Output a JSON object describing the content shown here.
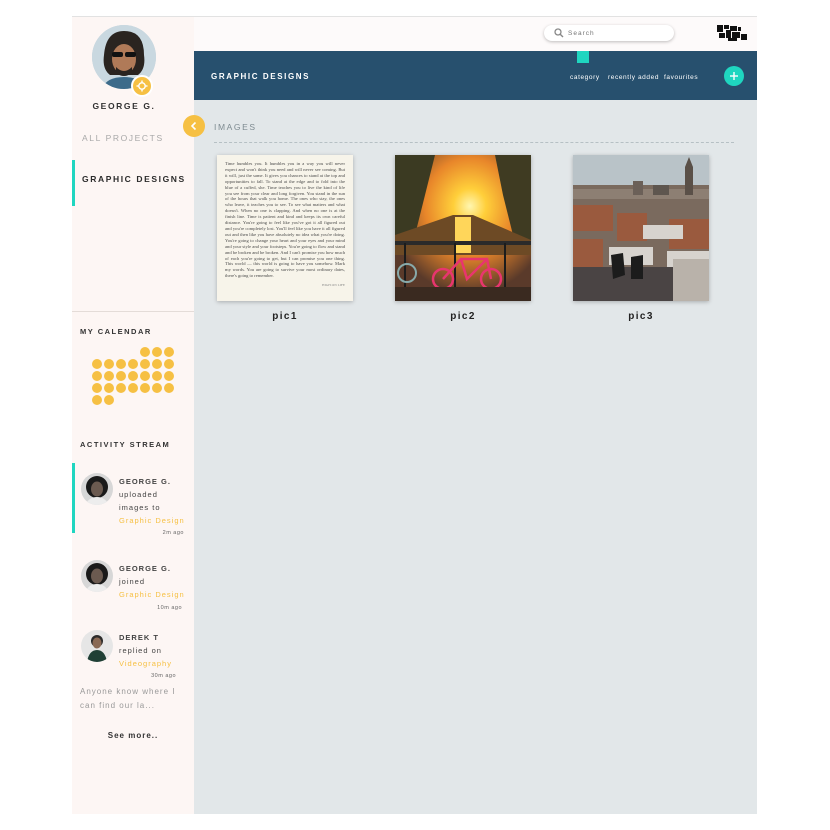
{
  "sidebar": {
    "user_name": "GEORGE G.",
    "nav": {
      "all_projects": "ALL PROJECTS",
      "active": "GRAPHIC DESIGNS"
    },
    "calendar_title": "MY CALENDAR",
    "activity_title": "ACTIVITY STREAM",
    "activities": [
      {
        "name": "GEORGE G.",
        "action": "uploaded images to",
        "target": "Graphic Design",
        "time": "2m ago"
      },
      {
        "name": "GEORGE G.",
        "action": "joined",
        "target": "Graphic Design",
        "time": "10m ago"
      },
      {
        "name": "DEREK T",
        "action": "replied on",
        "target": "Videography",
        "time": "30m ago"
      }
    ],
    "activity_extra": "Anyone know where I can find our la...",
    "see_more": "See more.."
  },
  "topbar": {
    "search_placeholder": "Search"
  },
  "header": {
    "title": "GRAPHIC DESIGNS",
    "tabs": [
      "category",
      "recently added",
      "favourites"
    ]
  },
  "main": {
    "section_title": "IMAGES",
    "images": [
      {
        "label": "pic1",
        "kind": "document"
      },
      {
        "label": "pic2",
        "kind": "photo-sunset-canal"
      },
      {
        "label": "pic3",
        "kind": "photo-city-rooftop"
      }
    ],
    "pic1_text": "Time humbles you. It humbles you in a way you will never expect and won't think you need and will never see coming. But it will, just the same. It gives you chances to stand at the top and opportunities to fall. To stand at the edge and to fold into the blue of a cuffed, she. Time teaches you to live the kind of life you see from your clear and long forgiven. You stand in the sun of the hours that walk you home. The ones who stay, the ones who leave, it teaches you to see. To see what matters and what doesn't. When no one is clapping. And when no one is at the finish line. Time is patient and kind and keeps its own careful distance. You're going to feel like you've got it all figured out and you're completely lost. You'll feel like you have it all figured out and then like you have absolutely no idea what you're doing. You're going to change your heart and your eyes and your mind and your style and your footsteps. You're going to flow and stand and be broken and be broken. And I can't promise you how much of each you're going to get, but I can promise you one thing. This world — this world is going to have you somehow. Mark my words. You are going to survive your most ordinary dates, there's going to remember.",
    "pic1_signature": "HIGH ON LIFE"
  },
  "colors": {
    "accent": "#1fd6c0",
    "yellow": "#f6c043",
    "header_bg": "#27506e",
    "main_bg": "#e2e7e9",
    "sidebar_bg": "#fdf6f4"
  },
  "icons": [
    "settings-icon",
    "chevron-left-icon",
    "search-icon",
    "plus-icon",
    "logo"
  ]
}
